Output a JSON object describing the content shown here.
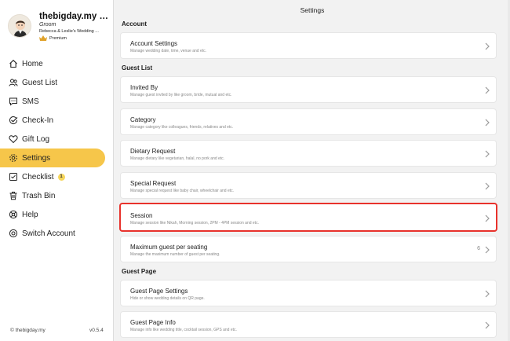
{
  "profile": {
    "name": "thebigday.my ad...",
    "role": "Groom",
    "wedding": "Rebecca & Leslie's Wedding ...",
    "plan": "Premium"
  },
  "nav": [
    {
      "label": "Home",
      "icon": "home-icon"
    },
    {
      "label": "Guest List",
      "icon": "guests-icon"
    },
    {
      "label": "SMS",
      "icon": "chat-icon"
    },
    {
      "label": "Check-In",
      "icon": "check-in-icon"
    },
    {
      "label": "Gift Log",
      "icon": "heart-icon"
    },
    {
      "label": "Settings",
      "icon": "gear-icon",
      "active": true
    },
    {
      "label": "Checklist",
      "icon": "checklist-icon",
      "badge": "1"
    },
    {
      "label": "Trash Bin",
      "icon": "trash-icon"
    },
    {
      "label": "Help",
      "icon": "help-icon"
    },
    {
      "label": "Switch Account",
      "icon": "switch-icon"
    }
  ],
  "footer": {
    "brand": "© thebigday.my",
    "version": "v0.5.4"
  },
  "main": {
    "title": "Settings",
    "sections": {
      "account": "Account",
      "guest_list": "Guest List",
      "guest_page": "Guest Page"
    },
    "cards": {
      "account_settings": {
        "title": "Account Settings",
        "subtitle": "Manage wedding date, time, venue and etc."
      },
      "invited_by": {
        "title": "Invited By",
        "subtitle": "Manage guest invited by like groom, bride, mutual and etc."
      },
      "category": {
        "title": "Category",
        "subtitle": "Manage category like colleagues, friends, relatives and etc."
      },
      "dietary": {
        "title": "Dietary Request",
        "subtitle": "Manage dietary like vegetarian, halal, no pork and etc."
      },
      "special": {
        "title": "Special Request",
        "subtitle": "Manage special request like baby chair, wheelchair and etc."
      },
      "session": {
        "title": "Session",
        "subtitle": "Manage session like Nikah, Morning session, 2PM - 4PM session and etc."
      },
      "max_guest": {
        "title": "Maximum guest per seating",
        "subtitle": "Manage the maximum number of guest per seating.",
        "value": "6"
      },
      "guest_page_settings": {
        "title": "Guest Page Settings",
        "subtitle": "Hide or show wedding details on QR page."
      },
      "guest_page_info": {
        "title": "Guest Page Info",
        "subtitle": "Manage info like wedding title, cocktail session, GPS and etc."
      }
    }
  },
  "colors": {
    "accent": "#f6c64a",
    "highlight": "#e8322c",
    "background": "#f2f2f2"
  }
}
